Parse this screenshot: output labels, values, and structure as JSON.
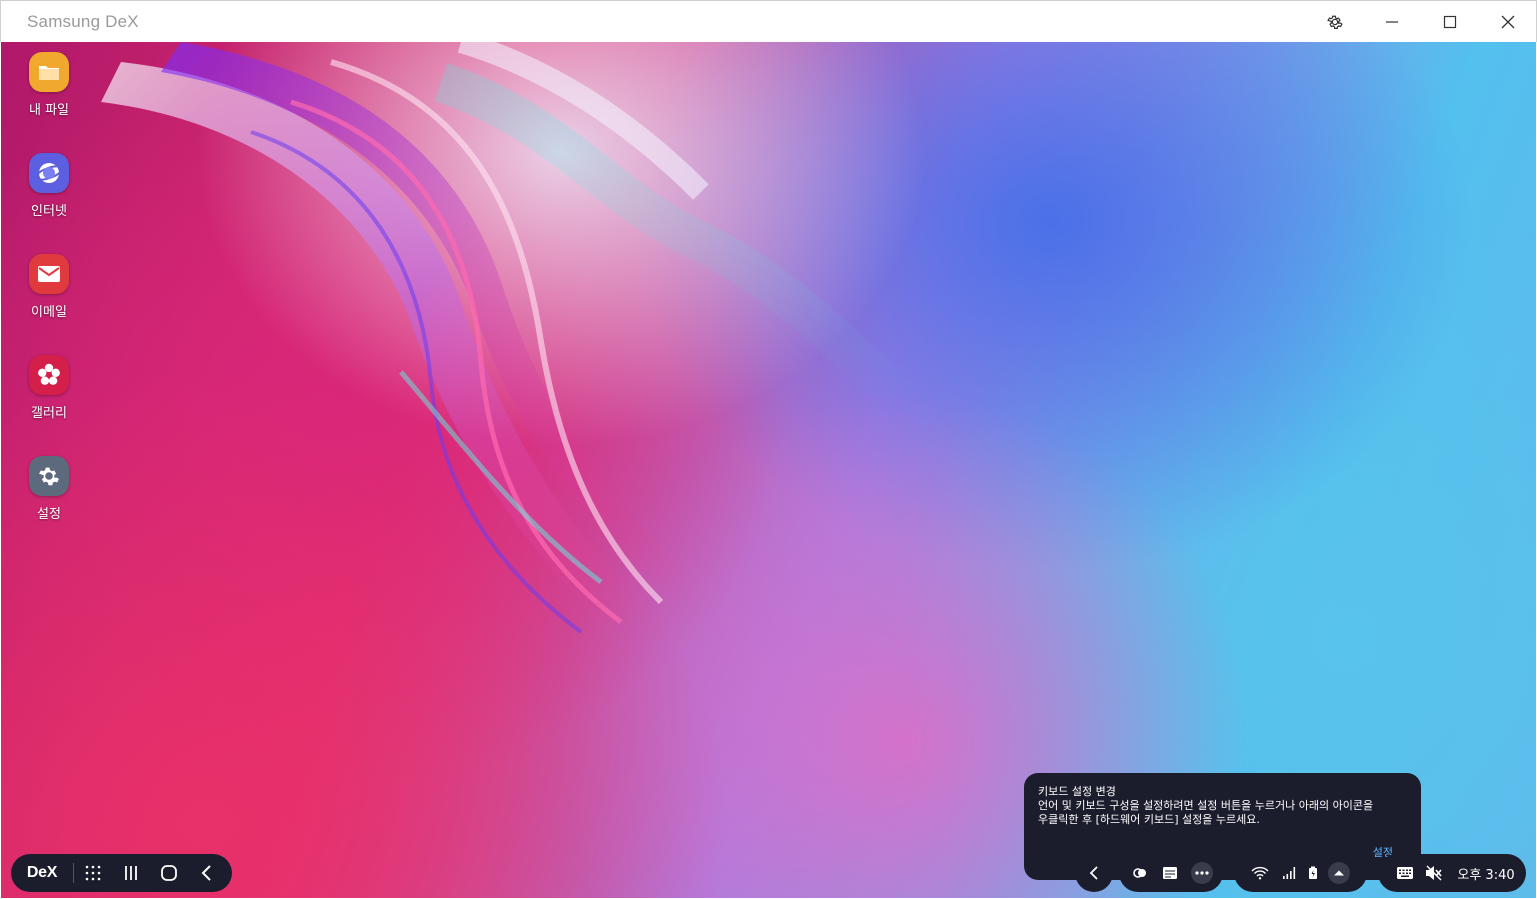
{
  "window": {
    "title": "Samsung DeX",
    "controls": [
      "settings-gear",
      "minimize",
      "maximize",
      "close"
    ]
  },
  "desktop_apps": [
    {
      "label": "내 파일",
      "icon": "folder-icon",
      "color": "#f0a82e"
    },
    {
      "label": "인터넷",
      "icon": "internet-icon",
      "color": "#5b5fe0"
    },
    {
      "label": "이메일",
      "icon": "email-icon",
      "color": "#e03a3e"
    },
    {
      "label": "갤러리",
      "icon": "gallery-flower-icon",
      "color": "#d41f4a"
    },
    {
      "label": "설정",
      "icon": "settings-icon",
      "color": "#5d6a7e"
    }
  ],
  "taskbar": {
    "dex_label": "DeX",
    "nav_buttons": [
      "apps-grid-icon",
      "recent-apps-icon",
      "home-icon",
      "back-icon"
    ],
    "clock": "오후 3:40"
  },
  "tooltip": {
    "title": "키보드 설정 변경",
    "body_line1": "언어 및 키보드 구성을 설정하려면 설정 버튼을 누르거나 아래의 아이콘을",
    "body_line2": "우클릭한 후 [하드웨어 키보드] 설정을 누르세요.",
    "action": "설정"
  },
  "colors": {
    "taskbar_bg": "#1b1d2c",
    "tooltip_action": "#5fb6ff",
    "title_text": "#9a9a9a"
  }
}
